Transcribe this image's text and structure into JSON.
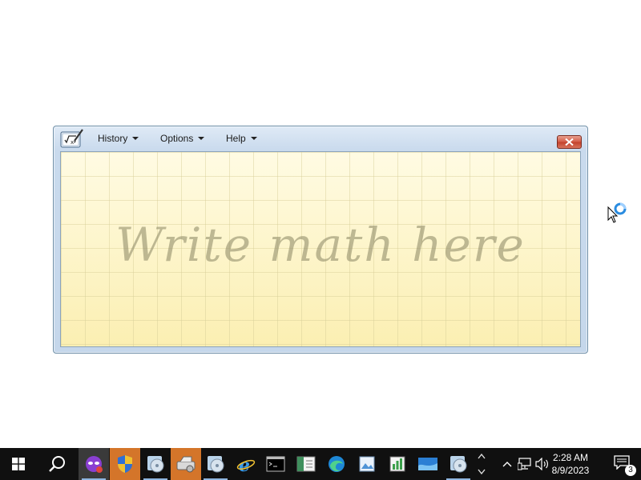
{
  "window": {
    "menu": [
      {
        "label": "History"
      },
      {
        "label": "Options"
      },
      {
        "label": "Help"
      }
    ],
    "placeholder": "Write math here"
  },
  "taskbar": {
    "icons": [
      "windows-start-icon",
      "search-icon",
      "app-mask-icon",
      "shield-icon",
      "disc-app-icon",
      "scanner-app-icon",
      "disc-app-icon-2",
      "internet-explorer-icon",
      "terminal-icon",
      "ledger-icon",
      "edge-icon",
      "picture-app-icon",
      "chart-app-icon",
      "wave-app-icon",
      "disc-app-icon-3"
    ],
    "clock_time": "2:28 AM",
    "clock_date": "8/9/2023",
    "notification_count": "3"
  },
  "colors": {
    "taskbar": "#101010",
    "writing_area": "#fdf5c8",
    "close_button": "#d35b45"
  }
}
